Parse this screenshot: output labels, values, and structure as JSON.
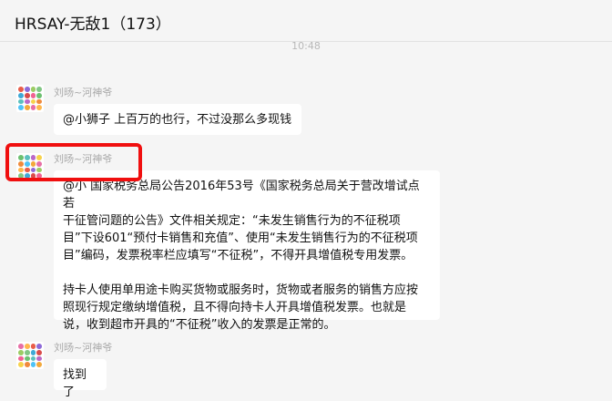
{
  "window": {
    "title": "HRSAY-无敌1（173）"
  },
  "timestamp": "10:48",
  "colors": {
    "highlight": "#f00f0f",
    "bubble": "#ffffff",
    "background": "#f5f5f5"
  },
  "messages": [
    {
      "sender": "刘旸~河神爷",
      "lines": [
        "@小狮子 上百万的也行，不过没那么多现钱"
      ]
    },
    {
      "sender": "刘旸~河神爷",
      "lines": [
        "@小 国家税务总局公告2016年53号《国家税务总局关于营改增试点若",
        "干征管问题的公告》文件相关规定：“未发生销售行为的不征税项",
        "目”下设601“预付卡销售和充值”、使用“未发生销售行为的不征税项",
        "目”编码，发票税率栏应填写“不征税”，不得开具增值税专用发票。",
        "",
        " 持卡人使用单用途卡购买货物或服务时，货物或者服务的销售方应按",
        "照现行规定缴纳增值税，且不得向持卡人开具增值税发票。也就是",
        "说，收到超市开具的“不征税”收入的发票是正常的。"
      ]
    },
    {
      "sender": "刘旸~河神爷",
      "lines": [
        "找到了"
      ]
    }
  ]
}
